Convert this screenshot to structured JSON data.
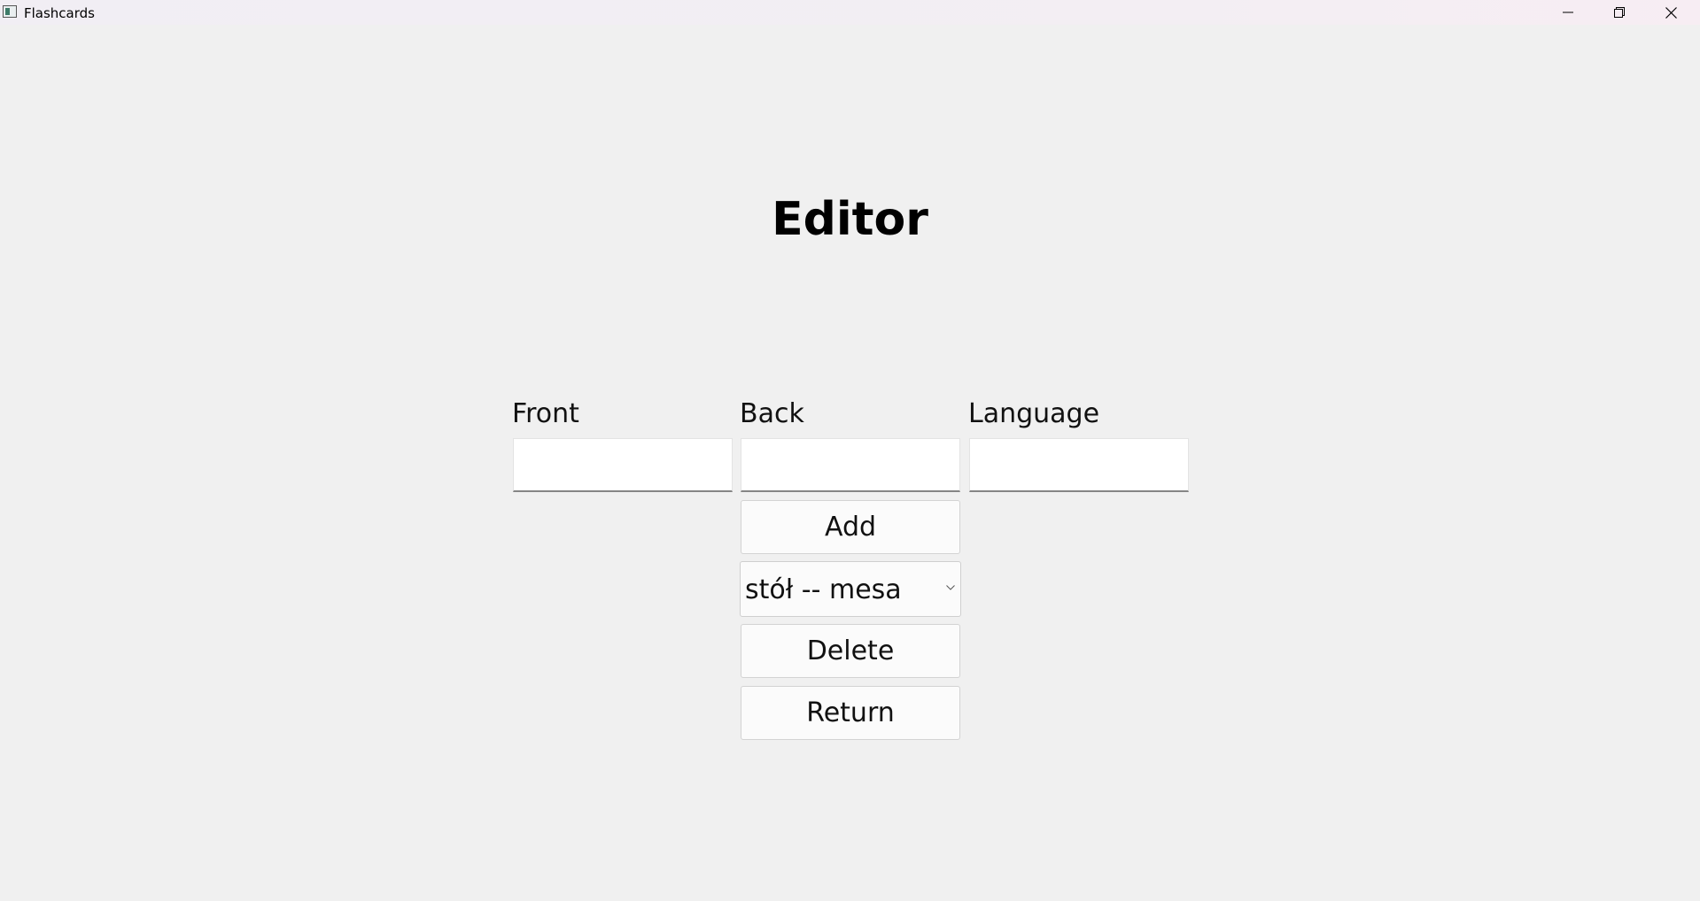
{
  "window": {
    "title": "Flashcards"
  },
  "editor": {
    "heading": "Editor",
    "labels": {
      "front": "Front",
      "back": "Back",
      "language": "Language"
    },
    "inputs": {
      "front_value": "",
      "back_value": "",
      "language_value": ""
    },
    "buttons": {
      "add": "Add",
      "delete": "Delete",
      "return": "Return"
    },
    "card_select": {
      "selected": "stół -- mesa"
    }
  }
}
